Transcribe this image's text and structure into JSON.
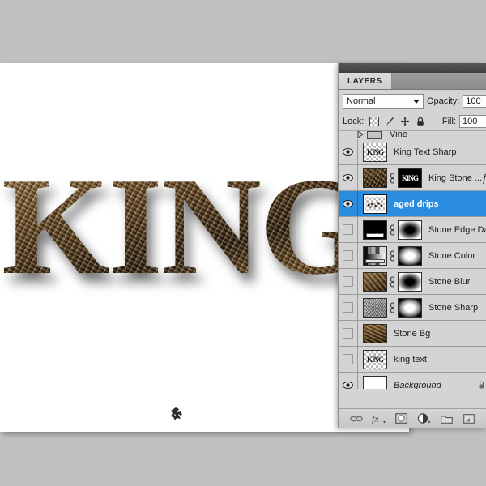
{
  "panel": {
    "tab_label": "LAYERS",
    "blend_mode": "Normal",
    "blend_modes": [
      "Normal"
    ],
    "opacity_label": "Opacity:",
    "opacity_value": "100",
    "fill_label": "Fill:",
    "fill_value": "100",
    "lock_label": "Lock:",
    "lock_icons": [
      "lock-transparency-icon",
      "lock-image-icon",
      "lock-position-icon",
      "lock-all-icon"
    ]
  },
  "layers": [
    {
      "name": "Vine",
      "visible": false,
      "partial": true,
      "kind": "group"
    },
    {
      "name": "King Text Sharp",
      "visible": true,
      "thumb": "checker-king",
      "selected": false
    },
    {
      "name": "King Stone ...",
      "visible": true,
      "thumb": "stone",
      "mask": "king-black",
      "linked": true,
      "fx": "f",
      "selected": false
    },
    {
      "name": "aged drips",
      "visible": true,
      "thumb": "checker-drips",
      "selected": true
    },
    {
      "name": "Stone Edge Dar",
      "visible": false,
      "thumb": "adj-black",
      "mask": "mask-dark",
      "linked": true,
      "selected": false
    },
    {
      "name": "Stone Color",
      "visible": false,
      "thumb": "adj-levels",
      "mask": "mask-light",
      "linked": true,
      "selected": false
    },
    {
      "name": "Stone Blur",
      "visible": false,
      "thumb": "stone-blur",
      "mask": "mask-dark",
      "linked": true,
      "selected": false
    },
    {
      "name": "Stone Sharp",
      "visible": false,
      "thumb": "stone-sharp",
      "mask": "mask-light",
      "linked": true,
      "selected": false
    },
    {
      "name": "Stone Bg",
      "visible": false,
      "thumb": "stone-bg",
      "selected": false
    },
    {
      "name": "king text",
      "visible": false,
      "thumb": "checker-king",
      "selected": false
    },
    {
      "name": "Background",
      "visible": true,
      "thumb": "white",
      "italic": true,
      "locked": true,
      "selected": false
    }
  ],
  "footer_buttons": [
    {
      "name": "link-layers-button",
      "icon": "link-icon"
    },
    {
      "name": "layer-style-button",
      "icon": "fx-icon"
    },
    {
      "name": "add-layer-mask-button",
      "icon": "mask-icon"
    },
    {
      "name": "new-fill-adjustment-button",
      "icon": "half-circle-icon"
    },
    {
      "name": "new-group-button",
      "icon": "folder-icon"
    },
    {
      "name": "new-layer-button",
      "icon": "new-layer-icon"
    }
  ],
  "canvas": {
    "artwork_text": "KING",
    "cursor_icon": "brush-cursor-icon"
  }
}
